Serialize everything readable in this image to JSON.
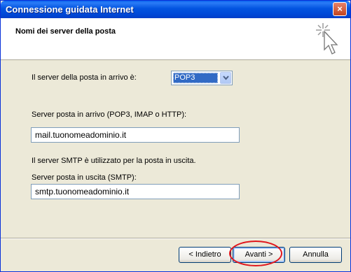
{
  "window": {
    "title": "Connessione guidata Internet",
    "close_label": "×"
  },
  "header": {
    "title": "Nomi dei server della posta",
    "icon": "wizard-sparkle-cursor-icon"
  },
  "form": {
    "incoming_type_label": "Il server della posta in arrivo è:",
    "incoming_type_value": "POP3",
    "incoming_server_label": "Server posta in arrivo (POP3, IMAP o HTTP):",
    "incoming_server_value": "mail.tuonomeadominio.it",
    "smtp_note": "Il server SMTP è utilizzato per la posta in uscita.",
    "outgoing_server_label": "Server posta in uscita (SMTP):",
    "outgoing_server_value": "smtp.tuonomeadominio.it"
  },
  "buttons": {
    "back": "< Indietro",
    "next": "Avanti >",
    "cancel": "Annulla"
  },
  "colors": {
    "titlebar": "#0054e3",
    "dialog_bg": "#ece9d8",
    "highlight_ring": "#e0171d"
  }
}
